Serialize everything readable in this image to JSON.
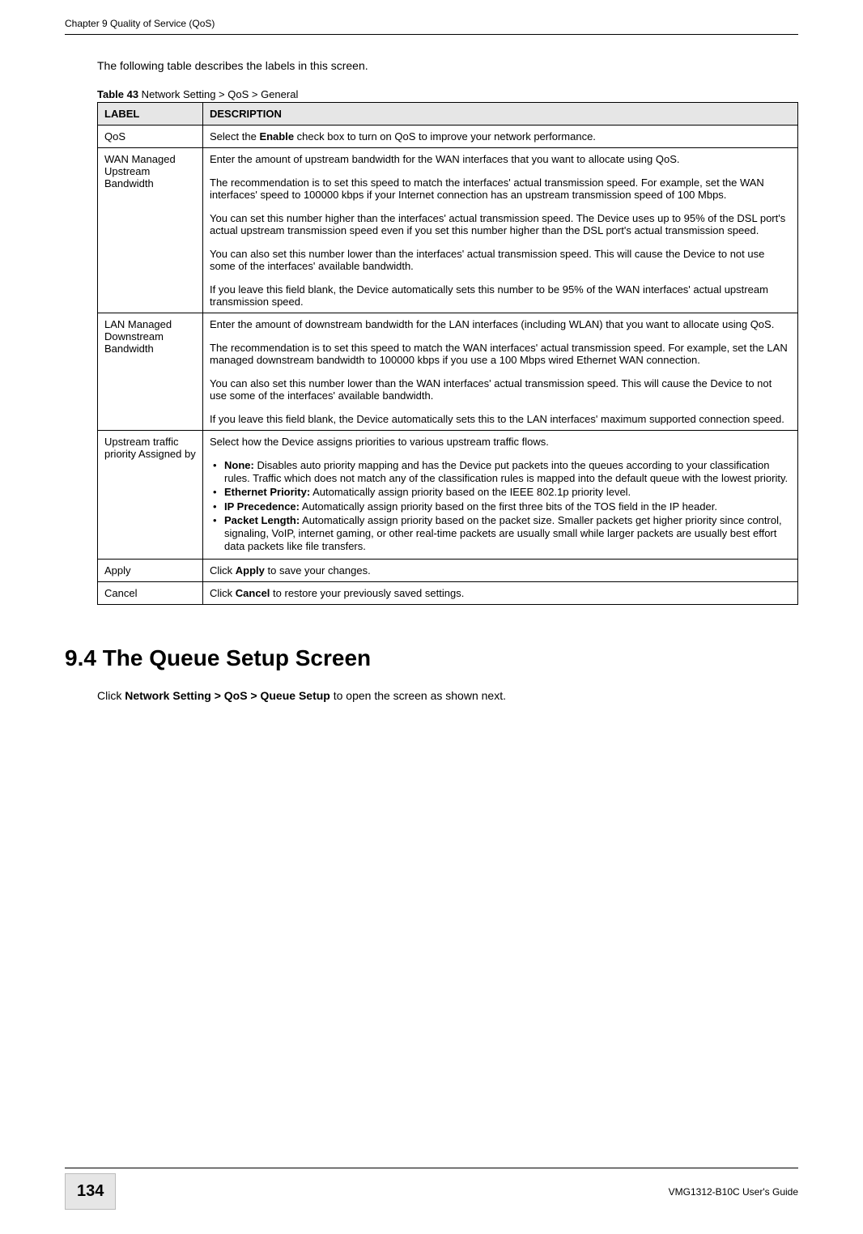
{
  "header": {
    "chapter": "Chapter 9 Quality of Service (QoS)"
  },
  "intro": "The following table describes the labels in this screen.",
  "table_caption": {
    "prefix": "Table 43",
    "rest": "   Network Setting > QoS > General"
  },
  "table_header": {
    "label": "LABEL",
    "desc": "DESCRIPTION"
  },
  "rows": {
    "qos": {
      "label": "QoS",
      "d1": "Select the ",
      "d_b": "Enable",
      "d2": " check box to turn on QoS to improve your network performance."
    },
    "wan": {
      "label": "WAN Managed Upstream Bandwidth",
      "p1": "Enter the amount of upstream bandwidth for the WAN interfaces that you want to allocate using QoS.",
      "p2": "The recommendation is to set this speed to match the interfaces' actual transmission speed. For example, set the WAN interfaces' speed to 100000 kbps if your Internet connection has an upstream transmission speed of 100 Mbps.",
      "p3": "You can set this number higher than the interfaces' actual transmission speed. The Device uses up to 95% of the DSL port's actual upstream transmission speed even if you set this number higher than the DSL port's actual transmission speed.",
      "p4": "You can also set this number lower than the interfaces' actual transmission speed. This will cause the Device to not use some of the interfaces' available bandwidth.",
      "p5": "If you leave this field blank, the Device automatically sets this number to be 95% of the WAN interfaces' actual upstream transmission speed."
    },
    "lan": {
      "label": "LAN Managed Downstream Bandwidth",
      "p1": "Enter the amount of downstream bandwidth for the LAN interfaces (including WLAN) that you want to allocate using QoS.",
      "p2": "The recommendation is to set this speed to match the WAN interfaces' actual transmission speed. For example, set the LAN managed downstream bandwidth to 100000 kbps if you use a 100 Mbps wired Ethernet WAN connection.",
      "p3": "You can also set this number lower than the WAN interfaces' actual transmission speed. This will cause the Device to not use some of the interfaces' available bandwidth.",
      "p4": "If you leave this field blank, the Device automatically sets this to the LAN interfaces' maximum supported connection speed."
    },
    "upstream": {
      "label": "Upstream traffic priority Assigned by",
      "intro": "Select how the Device assigns priorities to various upstream traffic flows.",
      "items": {
        "none_b": "None:",
        "none_t": " Disables auto priority mapping and has the Device put packets into the queues according to your classification rules. Traffic which does not match any of the classification rules is mapped into the default queue with the lowest priority.",
        "eth_b": "Ethernet Priority:",
        "eth_t": " Automatically assign priority based on the IEEE 802.1p priority level.",
        "ip_b": "IP Precedence:",
        "ip_t": " Automatically assign priority based on the first three bits of the TOS field in the IP header.",
        "pkt_b": "Packet Length:",
        "pkt_t": " Automatically assign priority based on the packet size. Smaller packets get higher priority since control, signaling, VoIP, internet gaming, or other real-time packets are usually small while larger packets are usually best effort data packets like file transfers."
      }
    },
    "apply": {
      "label": "Apply",
      "d1": "Click ",
      "d_b": "Apply",
      "d2": " to save your changes."
    },
    "cancel": {
      "label": "Cancel",
      "d1": "Click ",
      "d_b": "Cancel",
      "d2": " to restore your previously saved settings."
    }
  },
  "section": {
    "title": "9.4  The Queue Setup Screen",
    "body_1": "Click ",
    "body_b": "Network Setting > QoS > Queue Setup",
    "body_2": " to open the screen as shown next."
  },
  "footer": {
    "page": "134",
    "guide": "VMG1312-B10C User's Guide"
  }
}
